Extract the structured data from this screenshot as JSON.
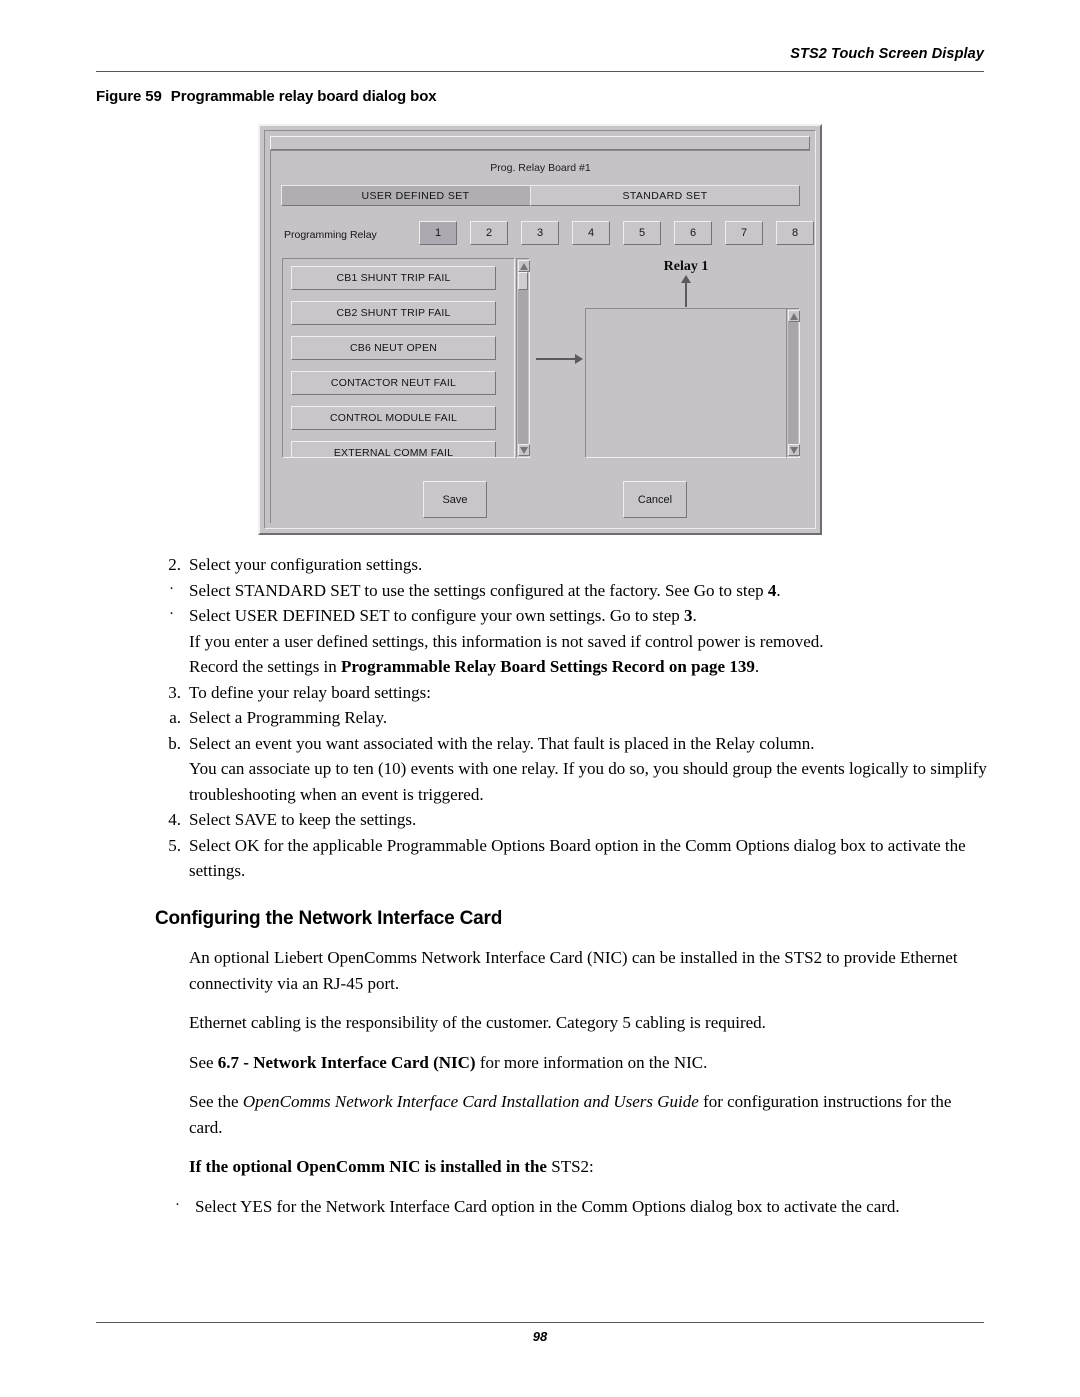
{
  "header": {
    "running_head": "STS2 Touch Screen Display",
    "page_number": "98"
  },
  "figure": {
    "label": "Figure 59",
    "caption": "Programmable relay board dialog box"
  },
  "dialog": {
    "title": "Prog. Relay Board #1",
    "set_buttons": [
      {
        "label": "USER DEFINED SET",
        "selected": true
      },
      {
        "label": "STANDARD SET",
        "selected": false
      }
    ],
    "programming_relay_label": "Programming Relay",
    "relay_numbers": [
      "1",
      "2",
      "3",
      "4",
      "5",
      "6",
      "7",
      "8"
    ],
    "selected_relay": "1",
    "event_list": [
      "CB1 SHUNT TRIP FAIL",
      "CB2 SHUNT TRIP FAIL",
      "CB6 NEUT OPEN",
      "CONTACTOR NEUT FAIL",
      "CONTROL MODULE FAIL",
      "EXTERNAL COMM FAIL"
    ],
    "relay_column_title": "Relay 1",
    "relay_column_items": [],
    "save_label": "Save",
    "cancel_label": "Cancel"
  },
  "body": {
    "step2": {
      "num": "2.",
      "text": "Select your configuration settings.",
      "bullets": [
        {
          "pre": "Select STANDARD SET to use the settings configured at the factory. See Go to step ",
          "bold": "4",
          "post": "."
        },
        {
          "pre": "Select USER DEFINED SET to configure your own settings. Go to step ",
          "bold": "3",
          "post": "."
        }
      ],
      "note_line1": "If you enter a user defined settings, this information is not saved if control power is removed.",
      "note_line2_pre": "Record the settings in ",
      "note_line2_bold": "Programmable Relay Board Settings Record on page 139",
      "note_line2_post": "."
    },
    "step3": {
      "num": "3.",
      "text": "To define your relay board settings:",
      "a": {
        "label": "a.",
        "text": "Select a Programming Relay."
      },
      "b": {
        "label": "b.",
        "text": "Select an event you want associated with the relay. That fault is placed in the Relay column.",
        "cont": "You can associate up to ten (10) events with one relay. If you do so, you should group the events logically to simplify troubleshooting when an event is triggered."
      }
    },
    "step4": {
      "num": "4.",
      "text": "Select SAVE to keep the settings."
    },
    "step5": {
      "num": "5.",
      "text": "Select OK for the applicable Programmable Options Board option in the Comm Options dialog box to activate the settings."
    },
    "section_heading": "Configuring the Network Interface Card",
    "para1": "An optional Liebert OpenComms Network Interface Card (NIC) can be installed in the STS2 to provide Ethernet connectivity via an RJ-45 port.",
    "para2": "Ethernet cabling is the responsibility of the customer. Category 5 cabling is required.",
    "para3_pre": "See ",
    "para3_bold": "6.7 - Network Interface Card (NIC)",
    "para3_post": " for more information on the NIC.",
    "para4_pre": "See the ",
    "para4_italic": "OpenComms Network Interface Card Installation and Users Guide",
    "para4_post": " for configuration instructions for the card.",
    "para5_bold": "If the optional OpenComm NIC is installed in the ",
    "para5_rest": "STS2:",
    "final_bullet": "Select YES for the Network Interface Card option in the Comm Options dialog box to activate the card.",
    "bullet_glyph": "·"
  }
}
